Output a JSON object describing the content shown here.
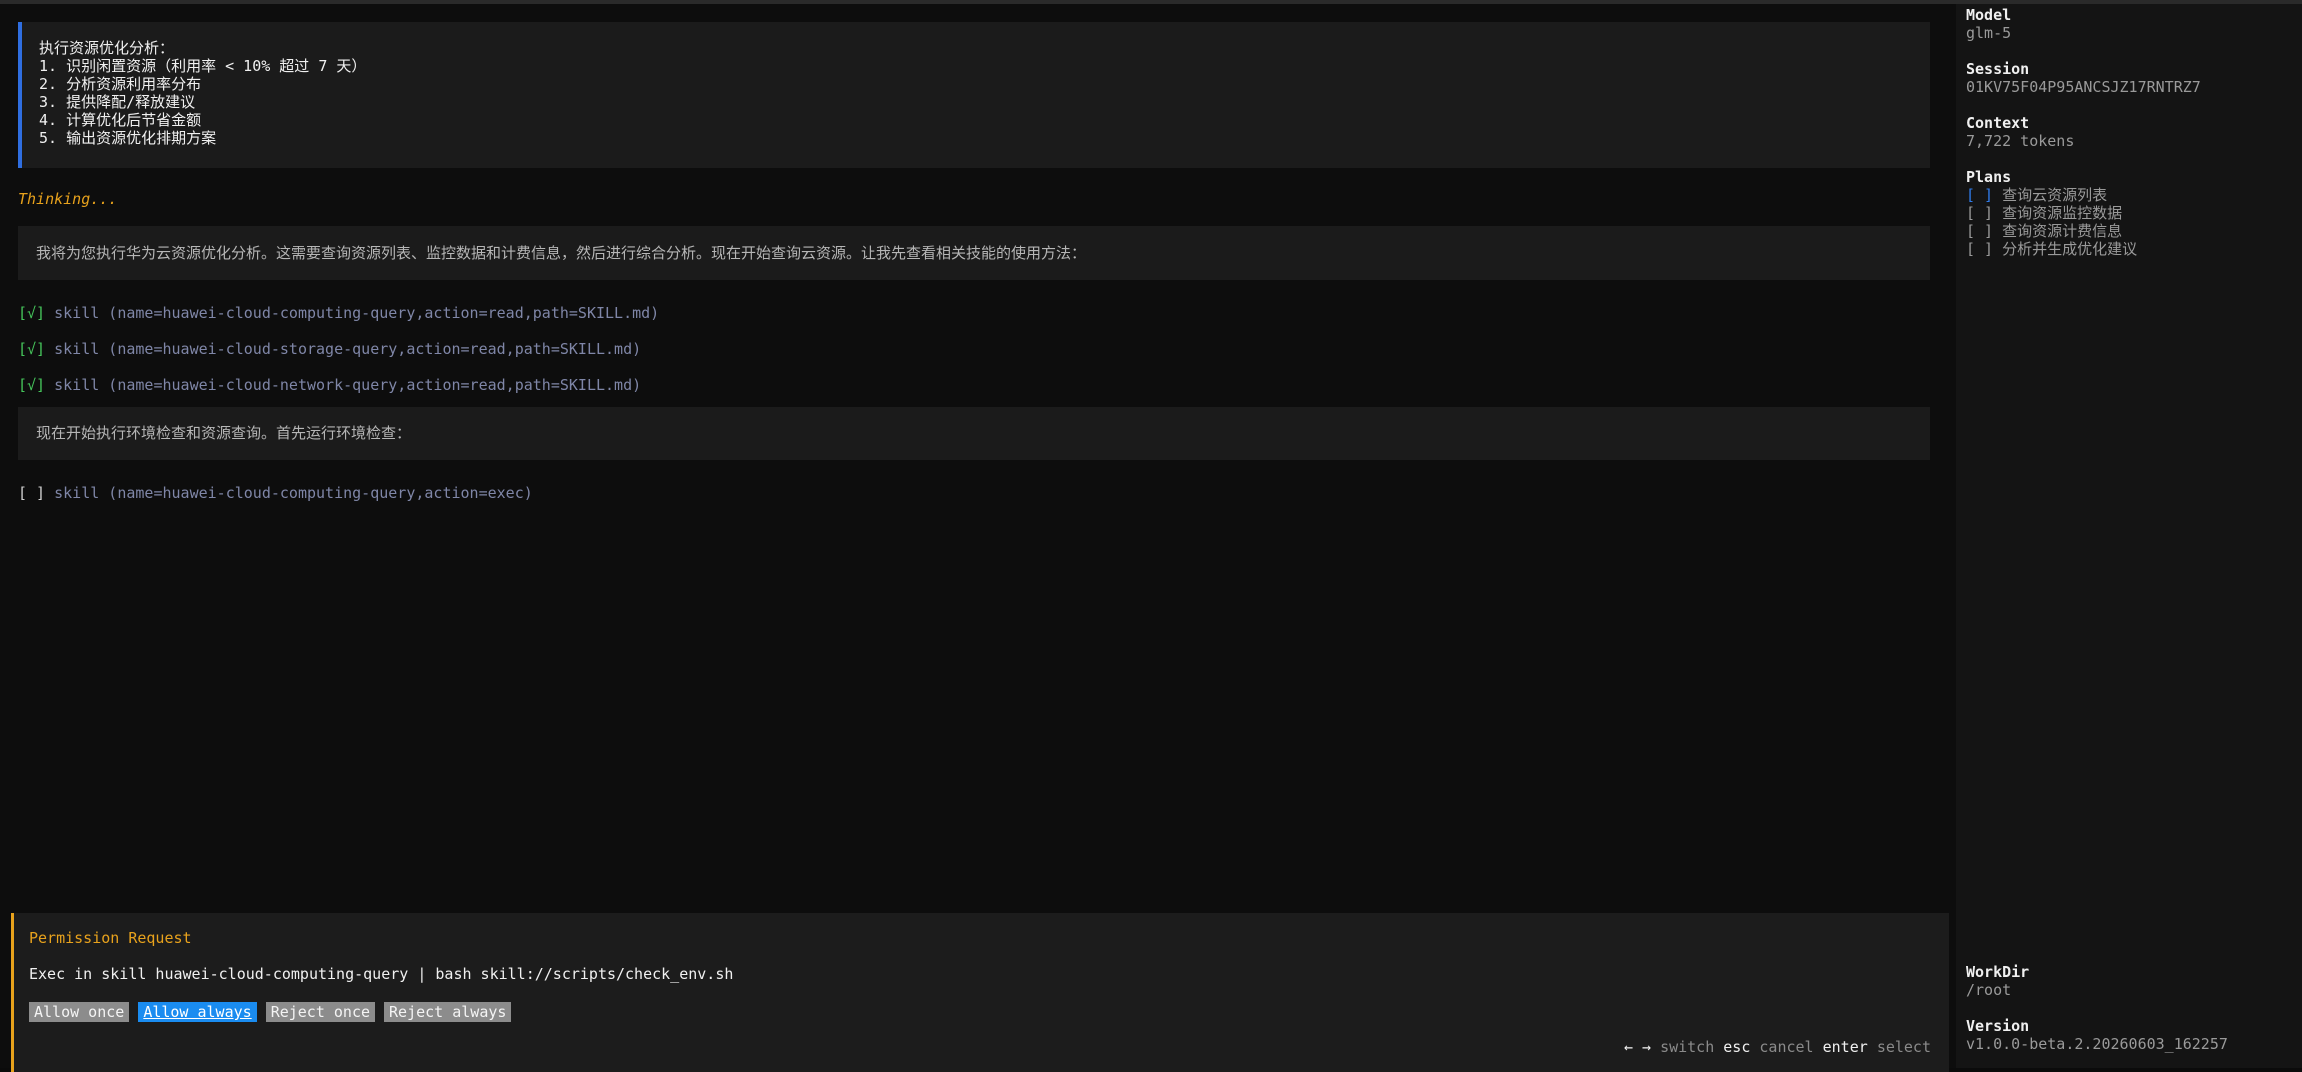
{
  "conversation": {
    "user_prompt_lines": [
      "执行资源优化分析：",
      "1. 识别闲置资源（利用率 < 10% 超过 7 天）",
      "2. 分析资源利用率分布",
      "3. 提供降配/释放建议",
      "4. 计算优化后节省金额",
      "5. 输出资源优化排期方案"
    ],
    "thinking": "Thinking...",
    "assistant_message_1": "我将为您执行华为云资源优化分析。这需要查询资源列表、监控数据和计费信息，然后进行综合分析。现在开始查询云资源。让我先查看相关技能的使用方法：",
    "tool_calls": [
      {
        "status": "[√]",
        "text": "skill (name=huawei-cloud-computing-query,action=read,path=SKILL.md)"
      },
      {
        "status": "[√]",
        "text": "skill (name=huawei-cloud-storage-query,action=read,path=SKILL.md)"
      },
      {
        "status": "[√]",
        "text": "skill (name=huawei-cloud-network-query,action=read,path=SKILL.md)"
      }
    ],
    "assistant_message_2": "现在开始执行环境检查和资源查询。首先运行环境检查：",
    "pending_tool": {
      "status": "[ ]",
      "text": "skill (name=huawei-cloud-computing-query,action=exec)"
    }
  },
  "permission": {
    "title": "Permission Request",
    "command": "Exec in skill huawei-cloud-computing-query | bash skill://scripts/check_env.sh",
    "buttons": [
      "Allow once",
      "Allow always",
      "Reject once",
      "Reject always"
    ],
    "selected_index": 1,
    "hints": {
      "switch_key": "← →",
      "switch_label": "switch",
      "cancel_key": "esc",
      "cancel_label": "cancel",
      "select_key": "enter",
      "select_label": "select"
    }
  },
  "sidebar": {
    "model_label": "Model",
    "model_value": "glm-5",
    "session_label": "Session",
    "session_value": "01KV75F04P95ANCSJZ17RNTRZ7",
    "context_label": "Context",
    "context_value": "7,722 tokens",
    "plans_label": "Plans",
    "plans": [
      {
        "checkbox": "[ ]",
        "label": "查询云资源列表",
        "current": true
      },
      {
        "checkbox": "[ ]",
        "label": "查询资源监控数据",
        "current": false
      },
      {
        "checkbox": "[ ]",
        "label": "查询资源计费信息",
        "current": false
      },
      {
        "checkbox": "[ ]",
        "label": "分析并生成优化建议",
        "current": false
      }
    ],
    "workdir_label": "WorkDir",
    "workdir_value": "/root",
    "version_label": "Version",
    "version_value": "v1.0.0-beta.2.20260603_162257"
  },
  "colors": {
    "accent_blue": "#1a8cf0",
    "warning_orange": "#e8a21c",
    "success_green": "#45c45a",
    "user_border": "#2f6ee0"
  }
}
